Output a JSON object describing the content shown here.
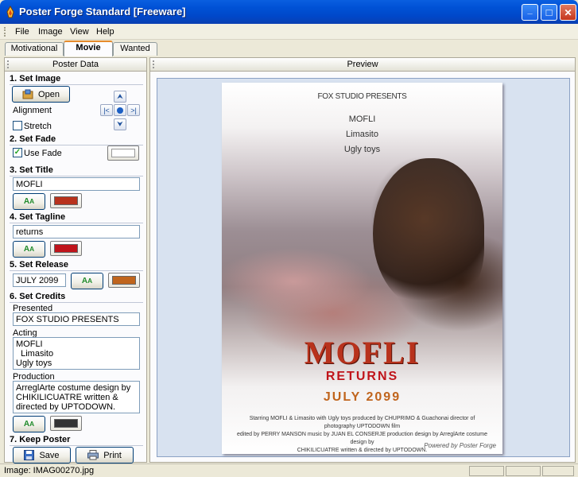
{
  "window": {
    "title": "Poster Forge Standard [Freeware]",
    "buttons": {
      "minimize": "_",
      "maximize": "□",
      "close": "✕"
    }
  },
  "menu": [
    "File",
    "Image",
    "View",
    "Help"
  ],
  "tabs": {
    "items": [
      "Motivational",
      "Movie",
      "Wanted"
    ],
    "active": "Movie"
  },
  "left": {
    "header": "Poster Data",
    "set_image": {
      "heading": "1. Set Image",
      "open_label": "Open",
      "alignment_label": "Alignment",
      "stretch_label": "Stretch",
      "stretch_checked": false
    },
    "set_fade": {
      "heading": "2. Set Fade",
      "use_fade_label": "Use Fade",
      "use_fade_checked": true,
      "color": "#ffffff"
    },
    "set_title": {
      "heading": "3. Set Title",
      "value": "MOFLI",
      "color": "#b8321c"
    },
    "set_tagline": {
      "heading": "4. Set Tagline",
      "value": "returns",
      "color": "#c0141a"
    },
    "set_release": {
      "heading": "5. Set Release",
      "value": "JULY 2099",
      "color": "#c0641c"
    },
    "set_credits": {
      "heading": "6. Set Credits",
      "presented_label": "Presented",
      "presented_value": "FOX STUDIO PRESENTS",
      "acting_label": "Acting",
      "acting_value": "MOFLI\n  Limasito\nUgly toys",
      "production_label": "Production",
      "production_value": "ArreglArte costume design by CHIKILICUATRE written & directed by UPTODOWN.",
      "color": "#333333"
    },
    "keep_poster": {
      "heading": "7. Keep Poster",
      "save_label": "Save",
      "print_label": "Print"
    }
  },
  "right": {
    "header": "Preview",
    "poster": {
      "presented": "FOX STUDIO PRESENTS",
      "acting": [
        "MOFLI",
        "Limasito",
        "Ugly toys"
      ],
      "title": "MOFLI",
      "tagline": "RETURNS",
      "release": "JULY 2099",
      "credits_line1": "Starring MOFLI & Limasito with Ugly toys produced by CHUPRIMO & Guachonai director of photography UPTODOWN film",
      "credits_line2": "edited by PERRY MANSON music by JUAN EL CONSERJE production design by ArreglArte costume design by",
      "credits_line3": "CHIKILICUATRE written & directed by UPTODOWN.",
      "watermark": "Powered by Poster Forge"
    }
  },
  "status": {
    "text": "Image: IMAG00270.jpg"
  }
}
